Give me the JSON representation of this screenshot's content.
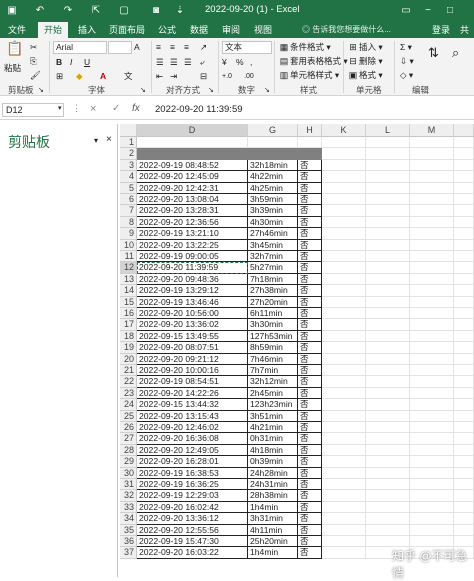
{
  "window": {
    "title": "2022-09-20 (1) - Excel",
    "login": "登录",
    "share": "共"
  },
  "menu": {
    "tabs": [
      "文件",
      "开始",
      "插入",
      "页面布局",
      "公式",
      "数据",
      "审阅",
      "视图"
    ],
    "active": "开始",
    "search_placeholder": "告诉我您想要做什么..."
  },
  "ribbon": {
    "clipboard": {
      "paste": "粘贴",
      "label": "剪贴板"
    },
    "font": {
      "name": "Arial",
      "label": "字体",
      "bold": "B",
      "italic": "I",
      "underline": "U"
    },
    "alignment": {
      "label": "对齐方式"
    },
    "number": {
      "format": "文本",
      "label": "数字"
    },
    "styles": {
      "conditional": "条件格式",
      "table": "套用表格格式",
      "cell": "单元格样式",
      "label": "样式"
    },
    "cells": {
      "insert": "插入",
      "delete": "删除",
      "format": "格式",
      "label": "单元格"
    },
    "editing": {
      "label": "编辑"
    }
  },
  "formula_bar": {
    "name_box": "D12",
    "cancel": "×",
    "confirm": "✓",
    "fx": "fx",
    "content": "2022-09-20 11:39:59"
  },
  "clipboard_pane": {
    "title": "剪贴板"
  },
  "sheet": {
    "columns": [
      "D",
      "G",
      "H",
      "K",
      "L",
      "M"
    ],
    "rows": [
      {
        "n": "1",
        "d": "",
        "g": "",
        "h": ""
      },
      {
        "n": "2",
        "d": "",
        "g": "",
        "h": ""
      },
      {
        "n": "3",
        "d": "2022-09-19 08:48:52",
        "g": "32h18min",
        "h": "否"
      },
      {
        "n": "4",
        "d": "2022-09-20 12:45:09",
        "g": "4h22min",
        "h": "否"
      },
      {
        "n": "5",
        "d": "2022-09-20 12:42:31",
        "g": "4h25min",
        "h": "否"
      },
      {
        "n": "6",
        "d": "2022-09-20 13:08:04",
        "g": "3h59min",
        "h": "否"
      },
      {
        "n": "7",
        "d": "2022-09-20 13:28:31",
        "g": "3h39min",
        "h": "否"
      },
      {
        "n": "8",
        "d": "2022-09-20 12:36:56",
        "g": "4h30min",
        "h": "否"
      },
      {
        "n": "9",
        "d": "2022-09-19 13:21:10",
        "g": "27h46min",
        "h": "否"
      },
      {
        "n": "10",
        "d": "2022-09-20 13:22:25",
        "g": "3h45min",
        "h": "否"
      },
      {
        "n": "11",
        "d": "2022-09-19 09:00:05",
        "g": "32h7min",
        "h": "否"
      },
      {
        "n": "12",
        "d": "2022-09-20 11:39:59",
        "g": "5h27min",
        "h": "否"
      },
      {
        "n": "13",
        "d": "2022-09-20 09:48:36",
        "g": "7h18min",
        "h": "否"
      },
      {
        "n": "14",
        "d": "2022-09-19 13:29:12",
        "g": "27h38min",
        "h": "否"
      },
      {
        "n": "15",
        "d": "2022-09-19 13:46:46",
        "g": "27h20min",
        "h": "否"
      },
      {
        "n": "16",
        "d": "2022-09-20 10:56:00",
        "g": "6h11min",
        "h": "否"
      },
      {
        "n": "17",
        "d": "2022-09-20 13:36:02",
        "g": "3h30min",
        "h": "否"
      },
      {
        "n": "18",
        "d": "2022-09-15 13:49:55",
        "g": "127h53min",
        "h": "否"
      },
      {
        "n": "19",
        "d": "2022-09-20 08:07:51",
        "g": "8h59min",
        "h": "否"
      },
      {
        "n": "20",
        "d": "2022-09-20 09:21:12",
        "g": "7h46min",
        "h": "否"
      },
      {
        "n": "21",
        "d": "2022-09-20 10:00:16",
        "g": "7h7min",
        "h": "否"
      },
      {
        "n": "22",
        "d": "2022-09-19 08:54:51",
        "g": "32h12min",
        "h": "否"
      },
      {
        "n": "23",
        "d": "2022-09-20 14:22:26",
        "g": "2h45min",
        "h": "否"
      },
      {
        "n": "24",
        "d": "2022-09-15 13:44:32",
        "g": "123h23min",
        "h": "否"
      },
      {
        "n": "25",
        "d": "2022-09-20 13:15:43",
        "g": "3h51min",
        "h": "否"
      },
      {
        "n": "26",
        "d": "2022-09-20 12:46:02",
        "g": "4h21min",
        "h": "否"
      },
      {
        "n": "27",
        "d": "2022-09-20 16:36:08",
        "g": "0h31min",
        "h": "否"
      },
      {
        "n": "28",
        "d": "2022-09-20 12:49:05",
        "g": "4h18min",
        "h": "否"
      },
      {
        "n": "29",
        "d": "2022-09-20 16:28:01",
        "g": "0h39min",
        "h": "否"
      },
      {
        "n": "30",
        "d": "2022-09-19 16:38:53",
        "g": "24h28min",
        "h": "否"
      },
      {
        "n": "31",
        "d": "2022-09-19 16:36:25",
        "g": "24h31min",
        "h": "否"
      },
      {
        "n": "32",
        "d": "2022-09-19 12:29:03",
        "g": "28h38min",
        "h": "否"
      },
      {
        "n": "33",
        "d": "2022-09-20 16:02:42",
        "g": "1h4min",
        "h": "否"
      },
      {
        "n": "34",
        "d": "2022-09-20 13:36:12",
        "g": "3h31min",
        "h": "否"
      },
      {
        "n": "35",
        "d": "2022-09-20 12:55:56",
        "g": "4h11min",
        "h": "否"
      },
      {
        "n": "36",
        "d": "2022-09-19 15:47:30",
        "g": "25h20min",
        "h": "否"
      },
      {
        "n": "37",
        "d": "2022-09-20 16:03:22",
        "g": "1h4min",
        "h": "否"
      }
    ]
  },
  "watermark": "知乎 @不可急情",
  "colors": {
    "brand": "#217346",
    "header_fill": "#808080"
  }
}
